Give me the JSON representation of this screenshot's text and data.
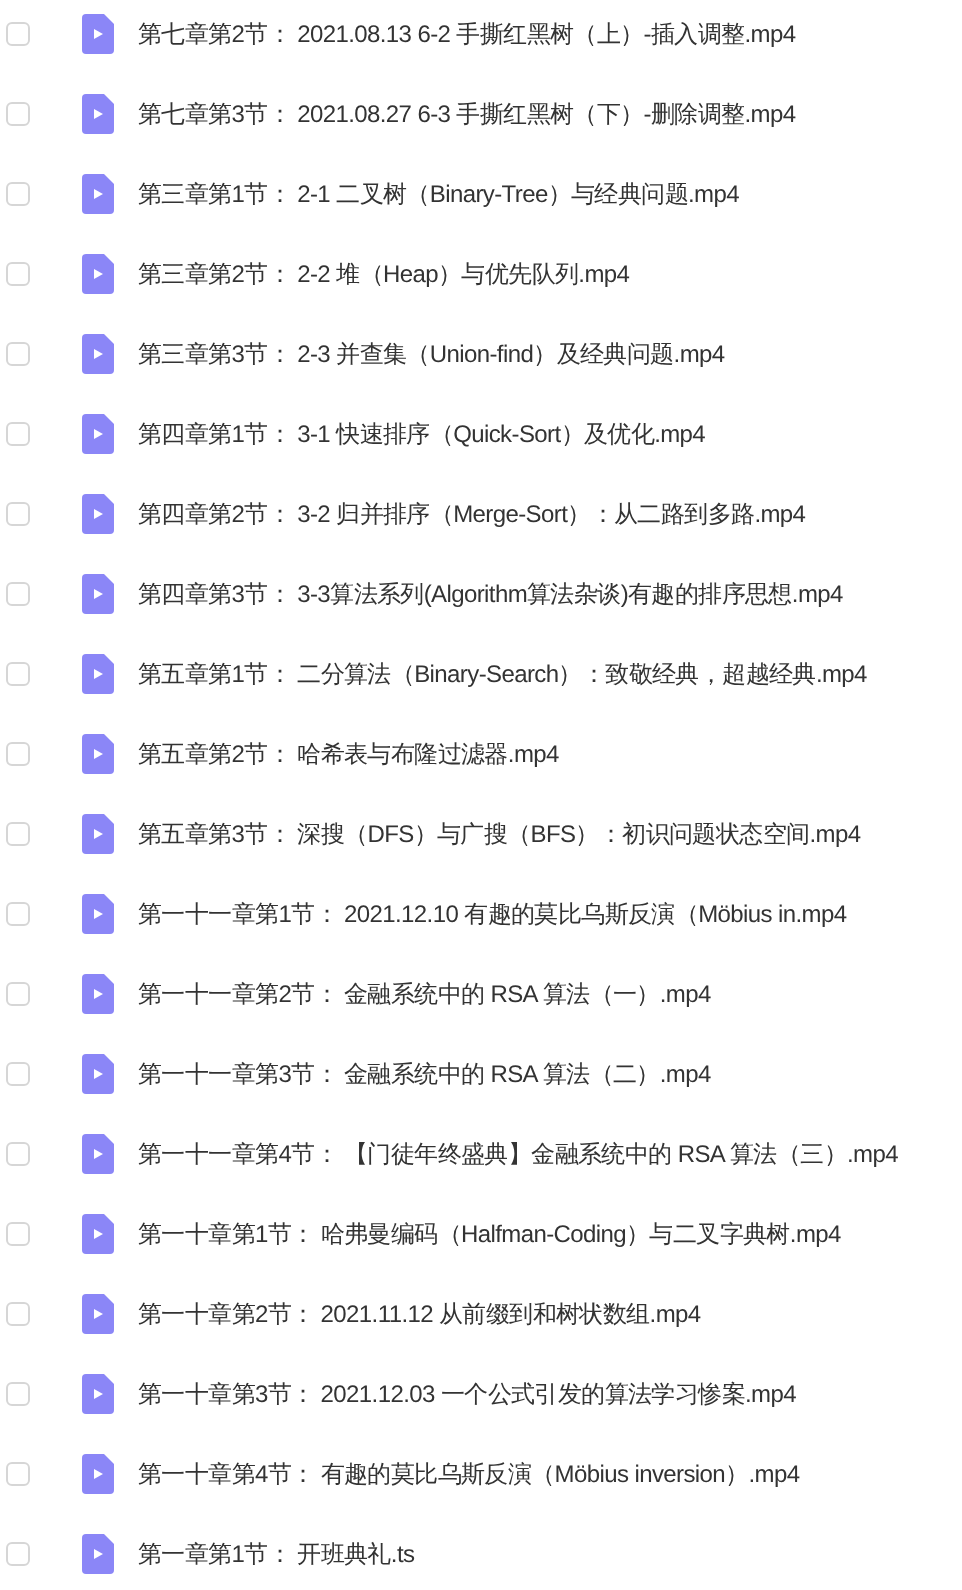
{
  "files": [
    {
      "name": "第七章第2节： 2021.08.13 6-2 手撕红黑树（上）-插入调整.mp4",
      "checked": false
    },
    {
      "name": "第七章第3节： 2021.08.27 6-3 手撕红黑树（下）-删除调整.mp4",
      "checked": false
    },
    {
      "name": "第三章第1节： 2-1 二叉树（Binary-Tree）与经典问题.mp4",
      "checked": false
    },
    {
      "name": "第三章第2节： 2-2 堆（Heap）与优先队列.mp4",
      "checked": false
    },
    {
      "name": "第三章第3节： 2-3 并查集（Union-find）及经典问题.mp4",
      "checked": false
    },
    {
      "name": "第四章第1节： 3-1 快速排序（Quick-Sort）及优化.mp4",
      "checked": false
    },
    {
      "name": "第四章第2节： 3-2 归并排序（Merge-Sort）：从二路到多路.mp4",
      "checked": false
    },
    {
      "name": "第四章第3节： 3-3算法系列(Algorithm算法杂谈)有趣的排序思想.mp4",
      "checked": false
    },
    {
      "name": "第五章第1节： 二分算法（Binary-Search）：致敬经典，超越经典.mp4",
      "checked": false
    },
    {
      "name": "第五章第2节： 哈希表与布隆过滤器.mp4",
      "checked": false
    },
    {
      "name": "第五章第3节： 深搜（DFS）与广搜（BFS）：初识问题状态空间.mp4",
      "checked": false
    },
    {
      "name": "第一十一章第1节： 2021.12.10 有趣的莫比乌斯反演（Möbius in.mp4",
      "checked": false
    },
    {
      "name": "第一十一章第2节： 金融系统中的 RSA 算法（一）.mp4",
      "checked": false
    },
    {
      "name": "第一十一章第3节： 金融系统中的 RSA 算法（二）.mp4",
      "checked": false
    },
    {
      "name": "第一十一章第4节： 【门徒年终盛典】金融系统中的 RSA 算法（三）.mp4",
      "checked": false
    },
    {
      "name": "第一十章第1节： 哈弗曼编码（Halfman-Coding）与二叉字典树.mp4",
      "checked": false
    },
    {
      "name": "第一十章第2节： 2021.11.12 从前缀到和树状数组.mp4",
      "checked": false
    },
    {
      "name": "第一十章第3节： 2021.12.03 一个公式引发的算法学习惨案.mp4",
      "checked": false
    },
    {
      "name": "第一十章第4节： 有趣的莫比乌斯反演（Möbius inversion）.mp4",
      "checked": false
    },
    {
      "name": "第一章第1节： 开班典礼.ts",
      "checked": false
    }
  ]
}
